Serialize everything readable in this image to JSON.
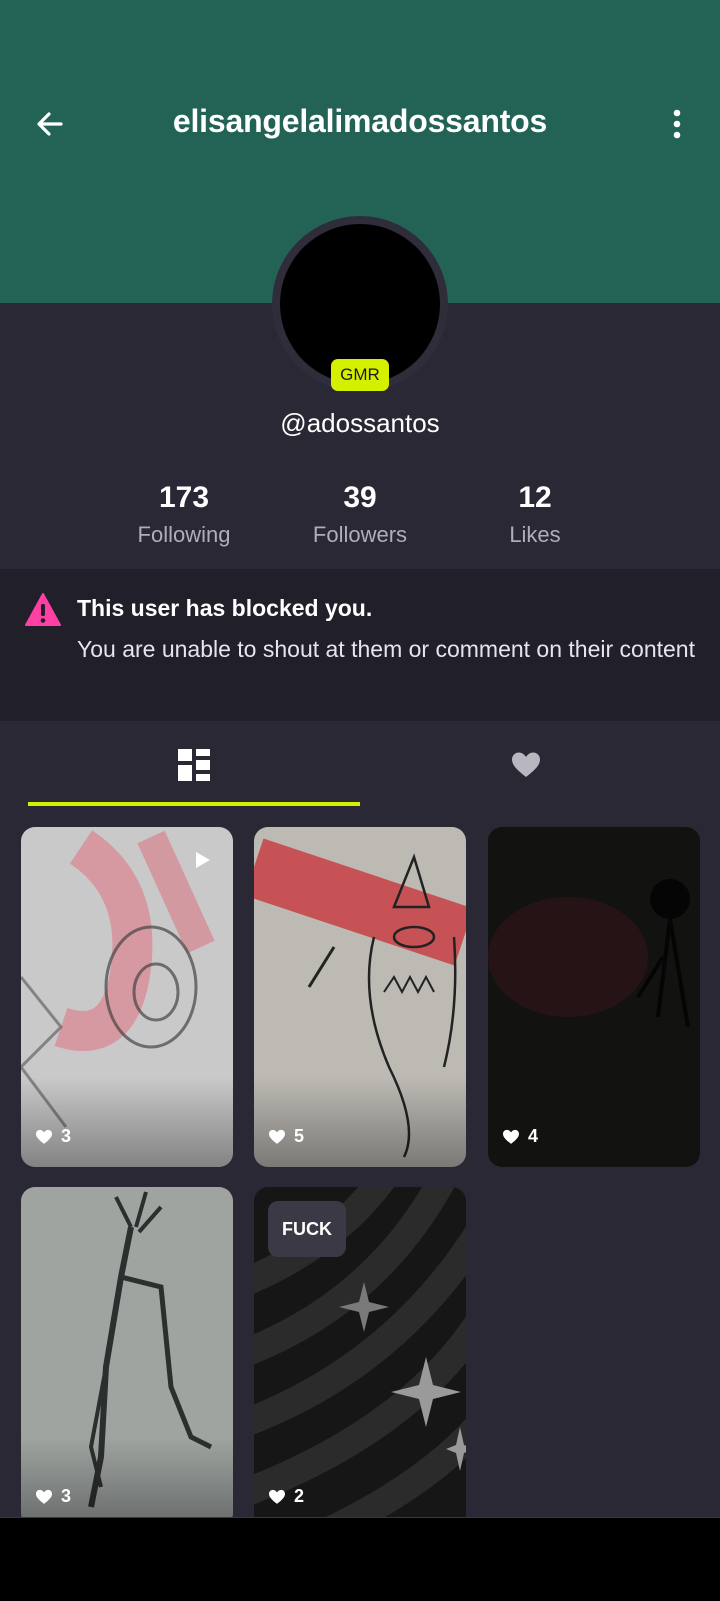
{
  "header": {
    "title": "elisangelalimadossantos",
    "back_icon": "arrow-left-icon",
    "more_icon": "more-vertical-icon",
    "color": "#236356"
  },
  "profile": {
    "badge": "GMR",
    "badge_color": "#d4f000",
    "handle": "@adossantos"
  },
  "stats": [
    {
      "value": "173",
      "label": "Following"
    },
    {
      "value": "39",
      "label": "Followers"
    },
    {
      "value": "12",
      "label": "Likes"
    }
  ],
  "notice": {
    "icon": "warning-icon",
    "icon_color": "#ff3fa4",
    "title": "This user has blocked you.",
    "description": "You are unable to shout at them or comment on their content"
  },
  "tabs": [
    {
      "name": "posts",
      "icon": "grid-icon",
      "active": true
    },
    {
      "name": "likes",
      "icon": "heart-icon",
      "active": false
    }
  ],
  "posts": [
    {
      "likes": "3",
      "video": true
    },
    {
      "likes": "5",
      "video": false
    },
    {
      "likes": "4",
      "video": false
    },
    {
      "likes": "3",
      "video": false
    },
    {
      "likes": "2",
      "video": false,
      "tag": "FUCK"
    }
  ]
}
